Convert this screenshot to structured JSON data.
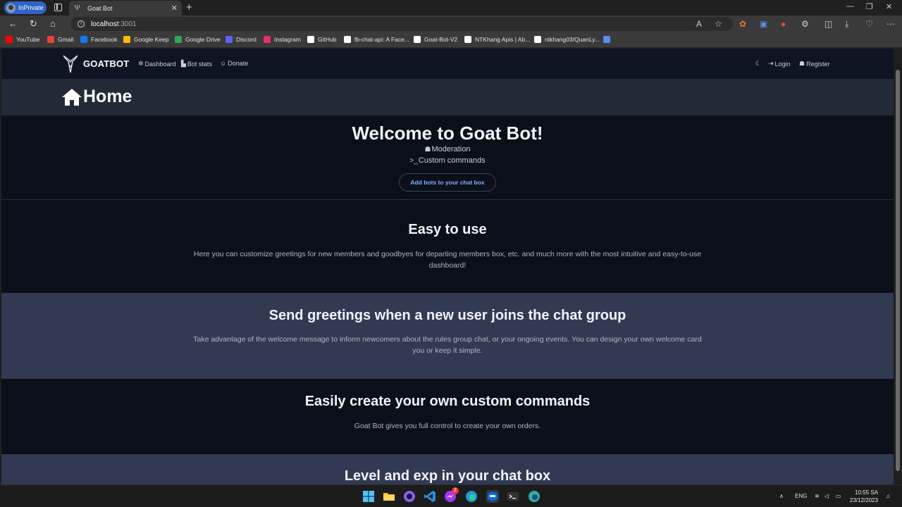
{
  "browser": {
    "profile_label": "InPrivate",
    "tab_title": "Goat Bot",
    "url_host": "localhost",
    "url_port": ":3001"
  },
  "bookmarks": [
    {
      "label": "YouTube",
      "color": "#ff0000"
    },
    {
      "label": "Gmail",
      "color": "#ea4335"
    },
    {
      "label": "Facebook",
      "color": "#1877f2"
    },
    {
      "label": "Google Keep",
      "color": "#fbbc04"
    },
    {
      "label": "Google Drive",
      "color": "#34a853"
    },
    {
      "label": "Discord",
      "color": "#5865f2"
    },
    {
      "label": "Instagram",
      "color": "#e1306c"
    },
    {
      "label": "GitHub",
      "color": "#ffffff"
    },
    {
      "label": "fb-chat-api: A Face...",
      "color": "#ffffff"
    },
    {
      "label": "Goat-Bot-V2",
      "color": "#ffffff"
    },
    {
      "label": "NTKhang Apis | Ab...",
      "color": "#ffffff"
    },
    {
      "label": "ntkhang03/QuanLy...",
      "color": "#ffffff"
    }
  ],
  "site": {
    "brand": "GOATBOT",
    "nav": {
      "dashboard": "Dashboard",
      "bot_stats": "Bot stats",
      "donate": "Donate",
      "login": "Login",
      "register": "Register"
    },
    "page_title": "Home",
    "hero": {
      "title": "Welcome to Goat Bot!",
      "feature_1": "Moderation",
      "feature_2": "Custom commands",
      "cta": "Add bots to your chat box"
    },
    "sections": [
      {
        "title": "Easy to use",
        "text": "Here you can customize greetings for new members and goodbyes for departing members box, etc. and much more with the most intuitive and easy-to-use dashboard!"
      },
      {
        "title": "Send greetings when a new user joins the chat group",
        "text": "Take advantage of the welcome message to inform newcomers about the rules group chat, or your ongoing events. You can design your own welcome card you or keep it simple."
      },
      {
        "title": "Easily create your own custom commands",
        "text": "Goat Bot gives you full control to create your own orders."
      },
      {
        "title": "Level and exp in your chat box",
        "text": ""
      }
    ]
  },
  "taskbar": {
    "language": "ENG",
    "time": "10:55 SA",
    "date": "23/12/2023",
    "messenger_badge": "2"
  }
}
